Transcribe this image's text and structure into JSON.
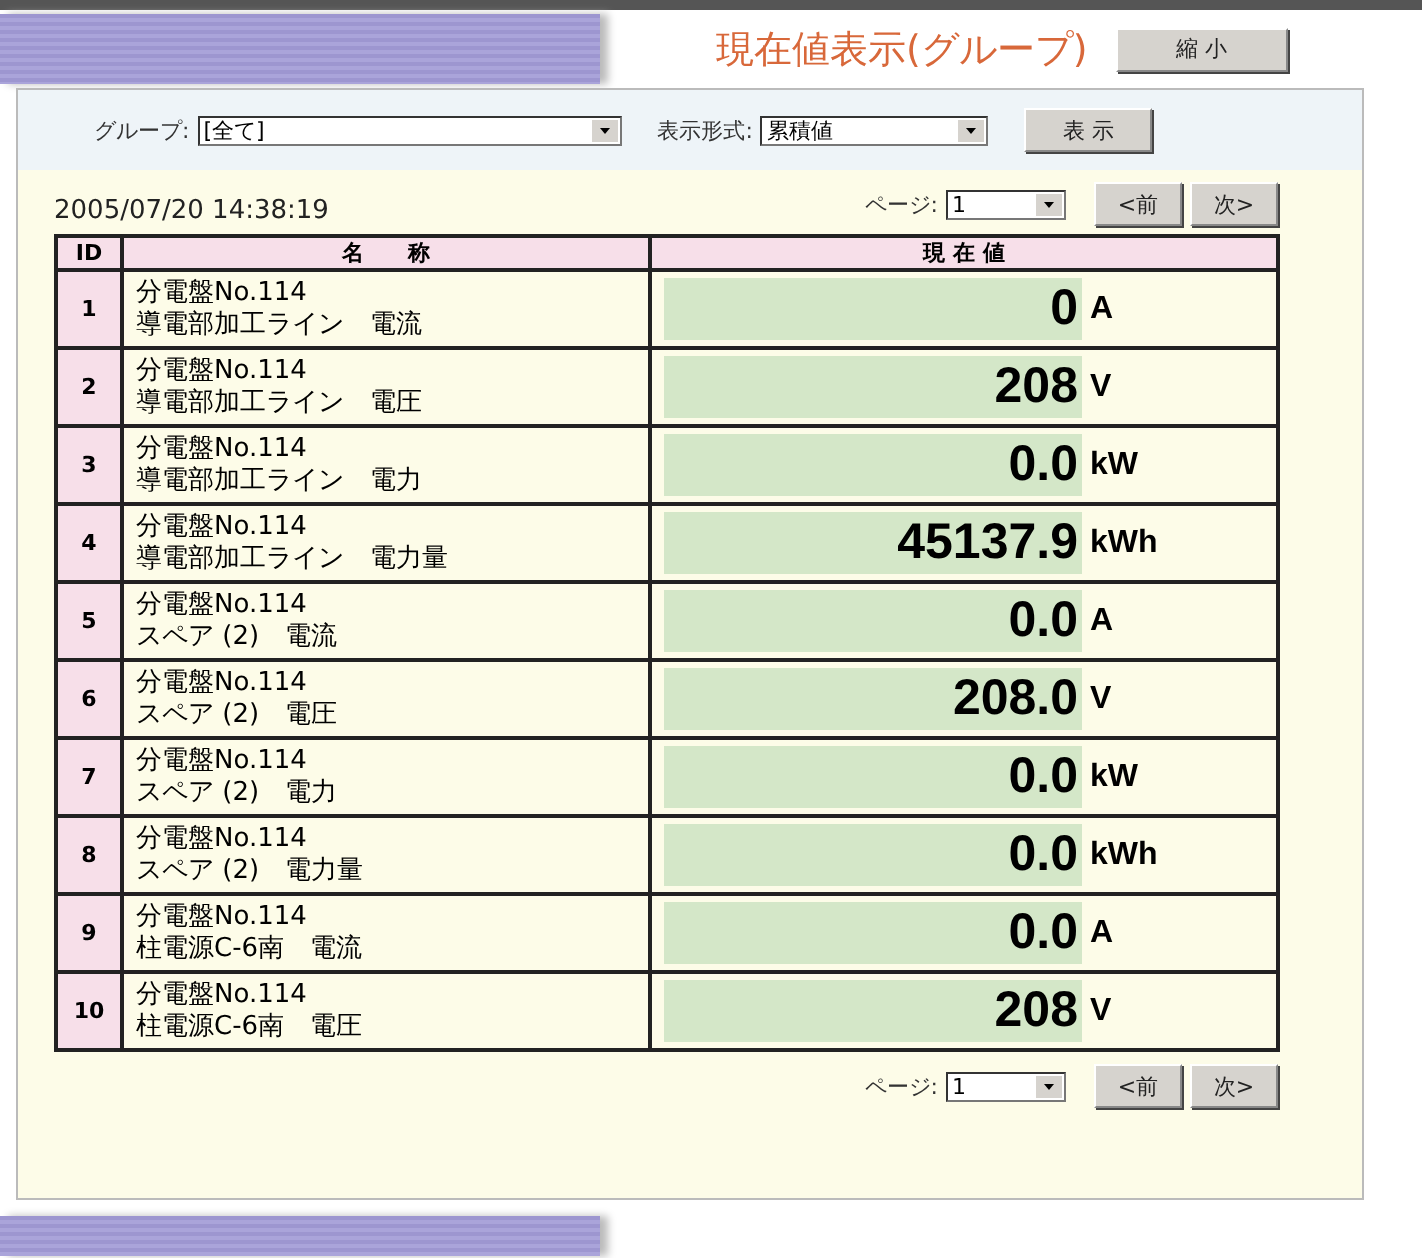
{
  "title": "現在値表示(グループ)",
  "shrink_button": "縮 小",
  "filter": {
    "group_label": "グループ:",
    "group_value": "[全て]",
    "format_label": "表示形式:",
    "format_value": "累積値",
    "show_button": "表 示"
  },
  "timestamp": "2005/07/20 14:38:19",
  "pager_top": {
    "label": "ページ:",
    "value": "1",
    "prev": "<前",
    "next": "次>"
  },
  "table": {
    "columns": [
      "ID",
      "名　　称",
      "現 在 値"
    ],
    "rows": [
      {
        "id": "1",
        "name_1": "分電盤No.114",
        "name_2": "導電部加工ライン　電流",
        "value": "0",
        "unit": "A"
      },
      {
        "id": "2",
        "name_1": "分電盤No.114",
        "name_2": "導電部加工ライン　電圧",
        "value": "208",
        "unit": "V"
      },
      {
        "id": "3",
        "name_1": "分電盤No.114",
        "name_2": "導電部加工ライン　電力",
        "value": "0.0",
        "unit": "kW"
      },
      {
        "id": "4",
        "name_1": "分電盤No.114",
        "name_2": "導電部加工ライン　電力量",
        "value": "45137.9",
        "unit": "kWh"
      },
      {
        "id": "5",
        "name_1": "分電盤No.114",
        "name_2": "スペア (2)　電流",
        "value": "0.0",
        "unit": "A"
      },
      {
        "id": "6",
        "name_1": "分電盤No.114",
        "name_2": "スペア (2)　電圧",
        "value": "208.0",
        "unit": "V"
      },
      {
        "id": "7",
        "name_1": "分電盤No.114",
        "name_2": "スペア (2)　電力",
        "value": "0.0",
        "unit": "kW"
      },
      {
        "id": "8",
        "name_1": "分電盤No.114",
        "name_2": "スペア (2)　電力量",
        "value": "0.0",
        "unit": "kWh"
      },
      {
        "id": "9",
        "name_1": "分電盤No.114",
        "name_2": "柱電源C-6南　電流",
        "value": "0.0",
        "unit": "A"
      },
      {
        "id": "10",
        "name_1": "分電盤No.114",
        "name_2": "柱電源C-6南　電圧",
        "value": "208",
        "unit": "V"
      }
    ]
  },
  "pager_bottom": {
    "label": "ページ:",
    "value": "1",
    "prev": "<前",
    "next": "次>"
  }
}
